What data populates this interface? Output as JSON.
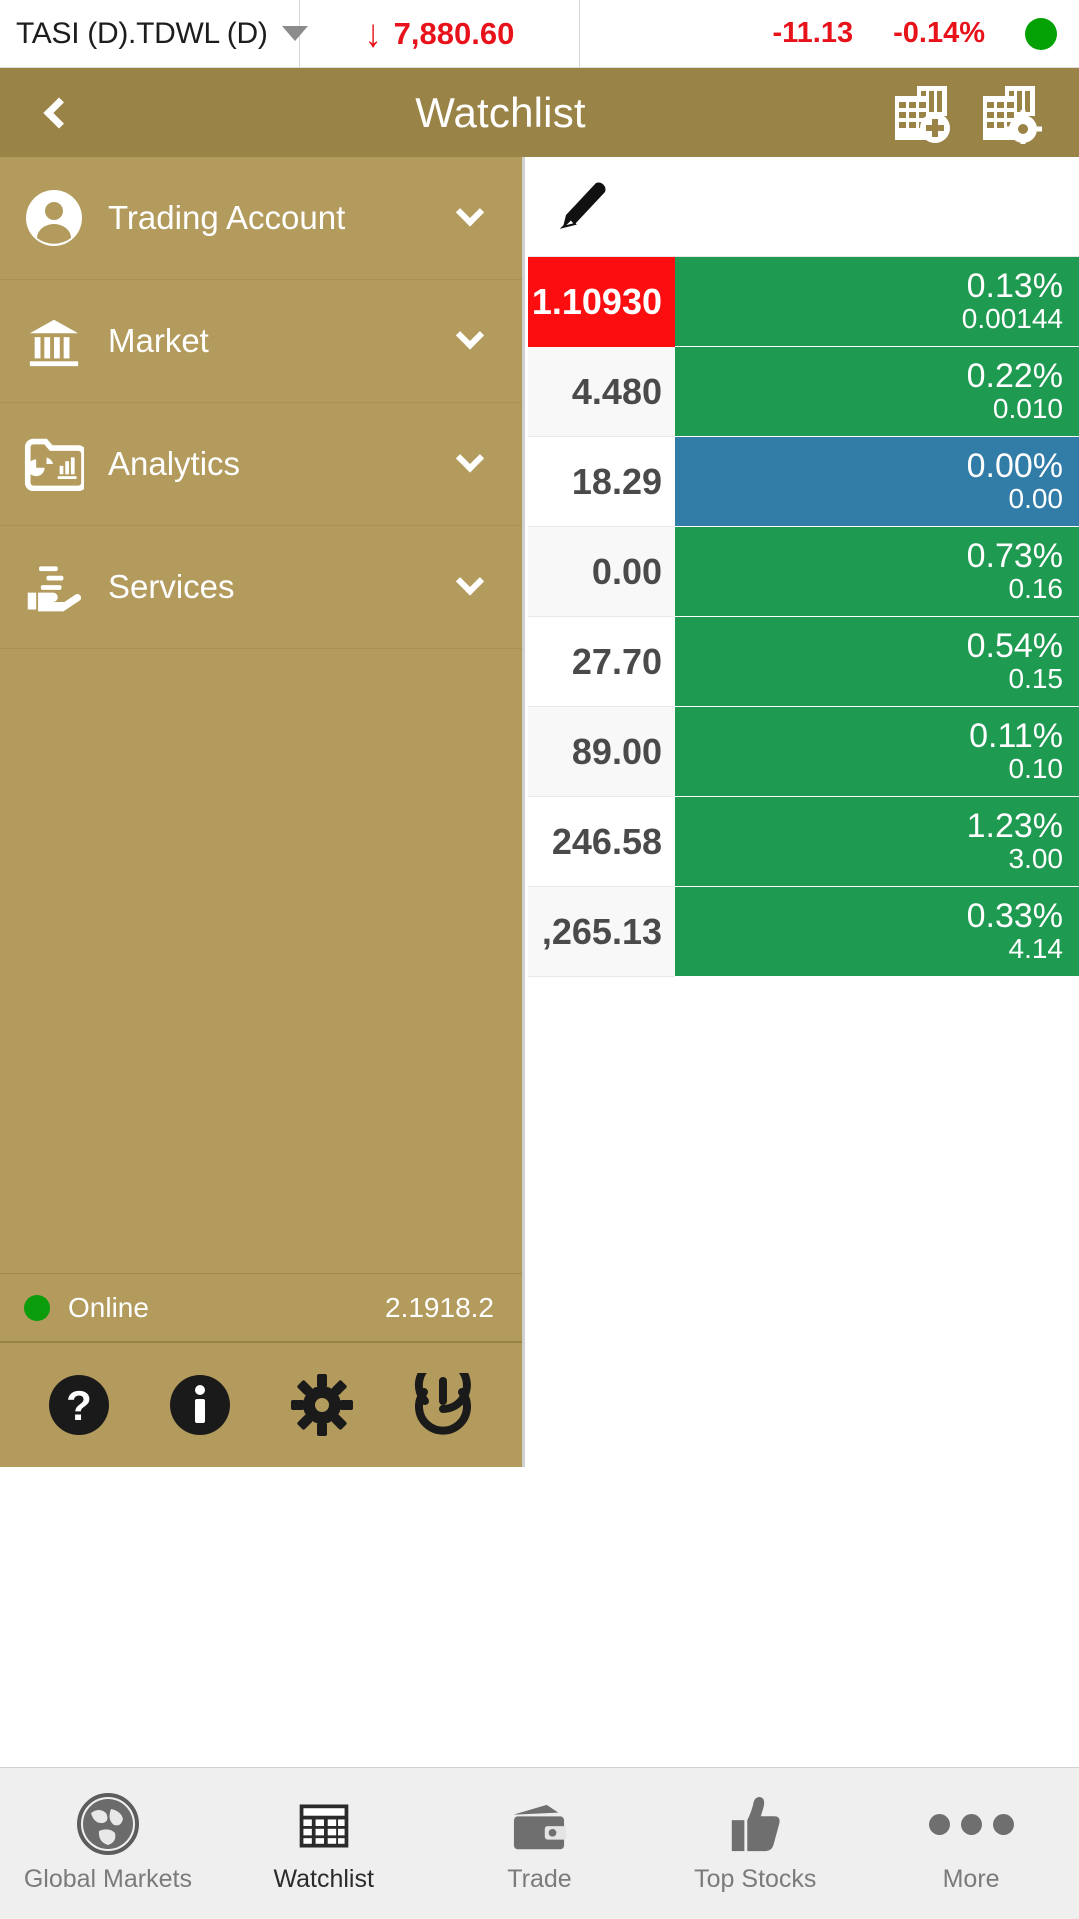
{
  "ticker": {
    "symbol": "TASI (D).TDWL (D)",
    "dropdown_icon": "caret-down-icon",
    "direction_icon": "arrow-down-icon",
    "last": "7,880.60",
    "change": "-11.13",
    "change_percent": "-0.14%",
    "status_dot_color": "#04a104",
    "negative_color": "#e8121b"
  },
  "header": {
    "back_icon": "chevron-left-icon",
    "title": "Watchlist",
    "add_watchlist_icon": "table-plus-icon",
    "settings_watchlist_icon": "table-gear-icon",
    "background": "#9a8347"
  },
  "sidebar": {
    "background": "#b29b5c",
    "items": [
      {
        "label": "Trading Account",
        "icon": "user-circle-icon",
        "chevron": "chevron-down-icon"
      },
      {
        "label": "Market",
        "icon": "bank-icon",
        "chevron": "chevron-down-icon"
      },
      {
        "label": "Analytics",
        "icon": "folder-chart-icon",
        "chevron": "chevron-down-icon"
      },
      {
        "label": "Services",
        "icon": "hand-service-icon",
        "chevron": "chevron-down-icon"
      }
    ],
    "status": {
      "label": "Online",
      "dot_color": "#0a9c0a",
      "version": "2.1918.2"
    },
    "footer_buttons": [
      {
        "icon": "help-icon"
      },
      {
        "icon": "info-icon"
      },
      {
        "icon": "gear-icon"
      },
      {
        "icon": "power-icon"
      }
    ]
  },
  "watchlist": {
    "edit_icon": "pencil-icon",
    "green": "#1f9a51",
    "blue": "#327ca8",
    "red": "#fb0d10",
    "rows": [
      {
        "price": "1.10930",
        "percent": "0.13%",
        "change": "0.00144",
        "state": "flash-red",
        "chg_state": "green"
      },
      {
        "price": "4.480",
        "percent": "0.22%",
        "change": "0.010",
        "state": "up-flash",
        "chg_state": "green"
      },
      {
        "price": "18.29",
        "percent": "0.00%",
        "change": "0.00",
        "state": "plain",
        "chg_state": "blue"
      },
      {
        "price": "0.00",
        "percent": "0.73%",
        "change": "0.16",
        "state": "up-flash",
        "chg_state": "green"
      },
      {
        "price": "27.70",
        "percent": "0.54%",
        "change": "0.15",
        "state": "plain",
        "chg_state": "green"
      },
      {
        "price": "89.00",
        "percent": "0.11%",
        "change": "0.10",
        "state": "up-flash",
        "chg_state": "green"
      },
      {
        "price": "246.58",
        "percent": "1.23%",
        "change": "3.00",
        "state": "plain",
        "chg_state": "green"
      },
      {
        "price": ",265.13",
        "percent": "0.33%",
        "change": "4.14",
        "state": "up-flash",
        "chg_state": "green"
      }
    ]
  },
  "bottom_nav": {
    "tabs": [
      {
        "label": "Global Markets",
        "icon": "globe-icon",
        "active": false
      },
      {
        "label": "Watchlist",
        "icon": "grid-table-icon",
        "active": true
      },
      {
        "label": "Trade",
        "icon": "wallet-icon",
        "active": false
      },
      {
        "label": "Top Stocks",
        "icon": "thumbs-up-icon",
        "active": false
      },
      {
        "label": "More",
        "icon": "ellipsis-icon",
        "active": false
      }
    ]
  }
}
